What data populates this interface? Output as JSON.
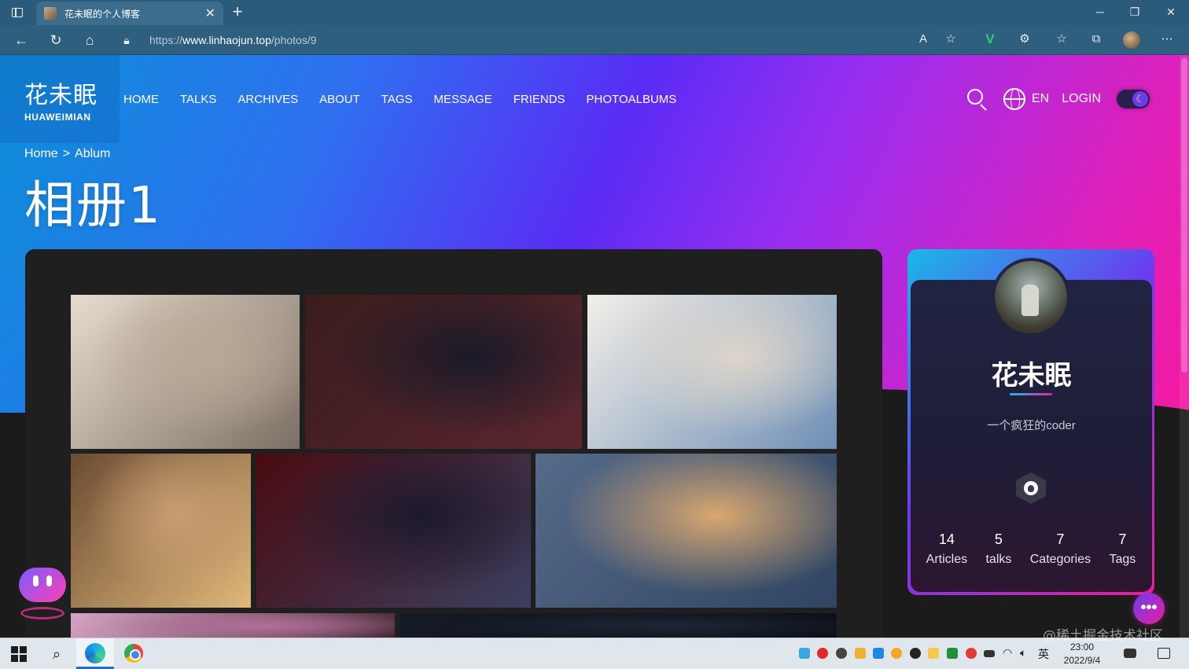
{
  "browser": {
    "tab_title": "花未眠的个人博客",
    "tab_close": "✕",
    "new_tab": "+",
    "url_prefix": "https://",
    "url_host": "www.linhaojun.top",
    "url_path": "/photos/9",
    "window_controls": {
      "minimize": "─",
      "maximize": "❐",
      "close": "✕"
    },
    "nav": {
      "back": "←",
      "reload": "↻",
      "home": "⌂"
    },
    "tools": [
      "A͏ᵃ",
      "☆",
      "V",
      "⚙",
      "☆≡",
      "⧉",
      "⋯"
    ]
  },
  "site": {
    "logo_cn": "花未眠",
    "logo_en": "HUAWEIMIAN",
    "nav": [
      "HOME",
      "TALKS",
      "ARCHIVES",
      "ABOUT",
      "TAGS",
      "MESSAGE",
      "FRIENDS",
      "PHOTOALBUMS"
    ],
    "lang": "EN",
    "login": "LOGIN",
    "toggle_icon": "☾"
  },
  "breadcrumb": {
    "home": "Home",
    "sep": ">",
    "current": "Ablum"
  },
  "page_title": "相册1",
  "album": {
    "photos": [
      {
        "name": "photo-elf-girl",
        "colors": [
          "#e7dccd",
          "#b8a896",
          "#7c6f64"
        ]
      },
      {
        "name": "photo-neon-street",
        "colors": [
          "#3a1c1c",
          "#1a1a28",
          "#5a2630"
        ]
      },
      {
        "name": "photo-girl-on-bed",
        "colors": [
          "#f3efe9",
          "#dcd4ca",
          "#6f8fb5"
        ]
      },
      {
        "name": "photo-anime-boy",
        "colors": [
          "#6b4b32",
          "#c89d72",
          "#e0b87a"
        ]
      },
      {
        "name": "photo-swordsman",
        "colors": [
          "#4a0b10",
          "#1c1a2c",
          "#3b3f60"
        ]
      },
      {
        "name": "photo-seaside-girls",
        "colors": [
          "#566a8a",
          "#d9a770",
          "#2f4560"
        ]
      },
      {
        "name": "photo-pink-sky",
        "colors": [
          "#d8a2c4",
          "#b36e98",
          "#402430"
        ]
      },
      {
        "name": "photo-night-sky",
        "colors": [
          "#151a26",
          "#1d2636",
          "#0c0f16"
        ]
      }
    ]
  },
  "profile": {
    "name": "花未眠",
    "motto": "一个疯狂的coder",
    "stats": [
      {
        "num": "14",
        "label": "Articles"
      },
      {
        "num": "5",
        "label": "talks"
      },
      {
        "num": "7",
        "label": "Categories"
      },
      {
        "num": "7",
        "label": "Tags"
      }
    ],
    "fab": "•••"
  },
  "taskbar": {
    "ime": "英",
    "time": "23:00",
    "date": "2022/9/4",
    "watermark": "@稀土掘金技术社区"
  }
}
